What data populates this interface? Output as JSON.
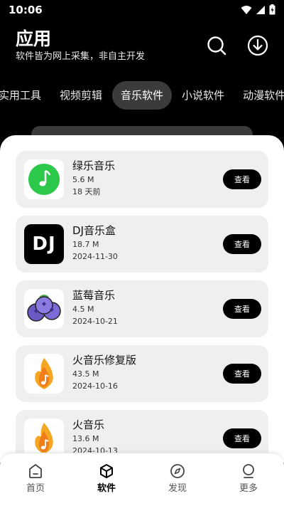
{
  "status_bar": {
    "time": "10:06"
  },
  "header": {
    "title": "应用",
    "subtitle": "软件皆为网上采集，非自主开发"
  },
  "tabs": [
    {
      "label": "实用工具",
      "active": false
    },
    {
      "label": "视频剪辑",
      "active": false
    },
    {
      "label": "音乐软件",
      "active": true
    },
    {
      "label": "小说软件",
      "active": false
    },
    {
      "label": "动漫软件",
      "active": false
    }
  ],
  "apps": [
    {
      "name": "绿乐音乐",
      "size": "5.6 M",
      "date": "18 天前",
      "button": "查看",
      "icon": "green-music-note-icon"
    },
    {
      "name": "DJ音乐盒",
      "size": "18.7 M",
      "date": "2024-11-30",
      "button": "查看",
      "icon": "dj-logo-icon",
      "icon_text": "DJ"
    },
    {
      "name": "蓝莓音乐",
      "size": "4.5 M",
      "date": "2024-10-21",
      "button": "查看",
      "icon": "blueberry-icon"
    },
    {
      "name": "火音乐修复版",
      "size": "43.5 M",
      "date": "2024-10-16",
      "button": "查看",
      "icon": "fire-music-icon"
    },
    {
      "name": "火音乐",
      "size": "13.6 M",
      "date": "2024-10-13",
      "button": "查看",
      "icon": "fire-music-icon"
    }
  ],
  "bottom_nav": [
    {
      "label": "首页",
      "icon": "home-icon",
      "active": false
    },
    {
      "label": "软件",
      "icon": "cube-icon",
      "active": true
    },
    {
      "label": "发现",
      "icon": "compass-icon",
      "active": false
    },
    {
      "label": "更多",
      "icon": "more-icon",
      "active": false
    }
  ],
  "colors": {
    "background": "#000000",
    "accent": "#000000",
    "card": "#efefef",
    "green_icon": "#2bc84a",
    "fire_icon": "#f5a623",
    "blueberry": "#6a5bc4"
  }
}
